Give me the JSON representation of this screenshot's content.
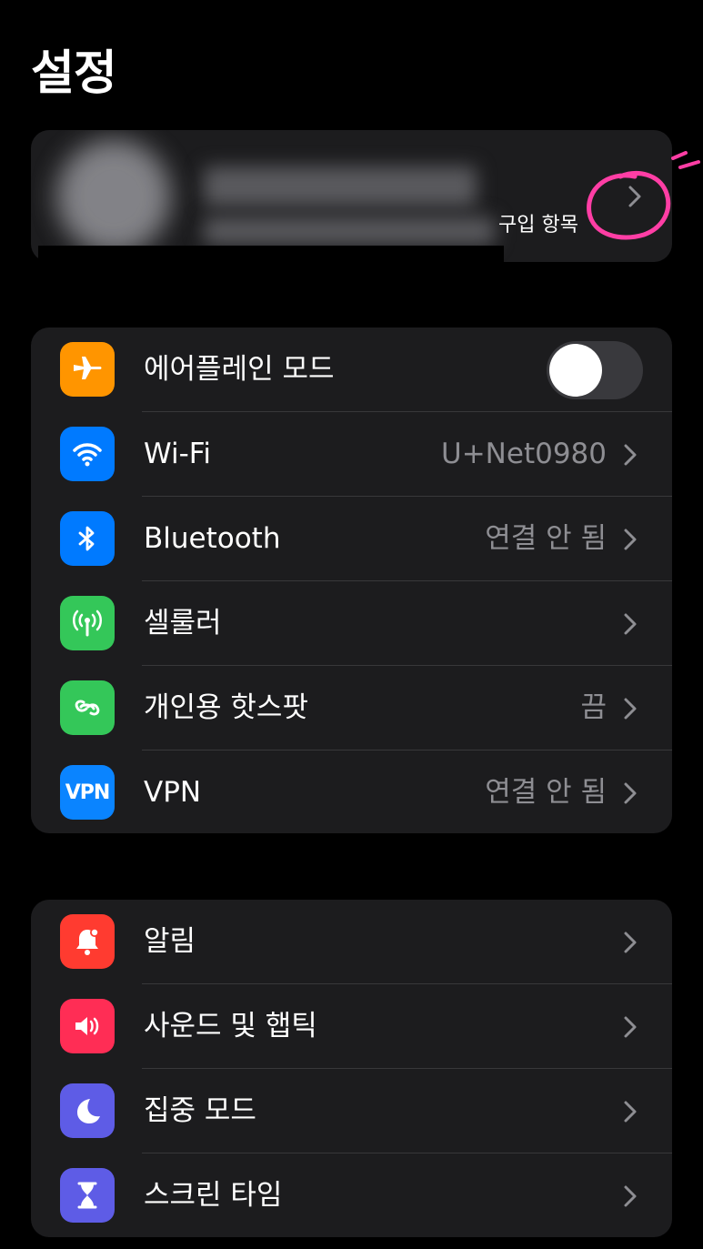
{
  "header": {
    "title": "설정"
  },
  "profile": {
    "subtitle": "구입 항목"
  },
  "group1": {
    "rows": [
      {
        "label": "에어플레인 모드",
        "icon": "airplane-icon",
        "icon_color": "#ff9500",
        "toggle": false
      },
      {
        "label": "Wi-Fi",
        "value": "U+Net0980",
        "icon": "wifi-icon",
        "icon_color": "#007aff"
      },
      {
        "label": "Bluetooth",
        "value": "연결 안 됨",
        "icon": "bluetooth-icon",
        "icon_color": "#007aff"
      },
      {
        "label": "셀룰러",
        "value": "",
        "icon": "cellular-icon",
        "icon_color": "#34c759"
      },
      {
        "label": "개인용 핫스팟",
        "value": "끔",
        "icon": "hotspot-icon",
        "icon_color": "#34c759"
      },
      {
        "label": "VPN",
        "value": "연결 안 됨",
        "icon": "vpn-icon",
        "icon_color": "#0a84ff",
        "icon_text": "VPN"
      }
    ]
  },
  "group2": {
    "rows": [
      {
        "label": "알림",
        "icon": "bell-icon",
        "icon_color": "#ff3b30"
      },
      {
        "label": "사운드 및 햅틱",
        "icon": "speaker-icon",
        "icon_color": "#ff2d55"
      },
      {
        "label": "집중 모드",
        "icon": "moon-icon",
        "icon_color": "#5e5ce6"
      },
      {
        "label": "스크린 타임",
        "icon": "hourglass-icon",
        "icon_color": "#5e5ce6"
      }
    ]
  }
}
